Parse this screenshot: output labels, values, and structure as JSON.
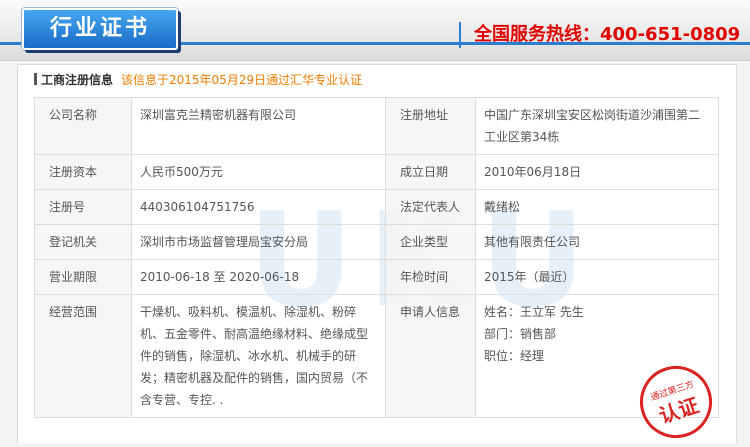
{
  "header": {
    "title": "行业证书",
    "hotline": "全国服务热线：400-651-0809"
  },
  "section": {
    "label": "工商注册信息",
    "note": "该信息于2015年05月29日通过汇华专业认证"
  },
  "rows": [
    {
      "k1": "公司名称",
      "v1": "深圳富克兰精密机器有限公司",
      "k2": "注册地址",
      "v2": "中国广东深圳宝安区松岗街道沙浦围第二工业区第34栋"
    },
    {
      "k1": "注册资本",
      "v1": "人民币500万元",
      "k2": "成立日期",
      "v2": "2010年06月18日"
    },
    {
      "k1": "注册号",
      "v1": "440306104751756",
      "k2": "法定代表人",
      "v2": "戴绪松"
    },
    {
      "k1": "登记机关",
      "v1": "深圳市市场监督管理局宝安分局",
      "k2": "企业类型",
      "v2": "其他有限责任公司"
    },
    {
      "k1": "营业期限",
      "v1": "2010-06-18 至 2020-06-18",
      "k2": "年检时间",
      "v2": "2015年（最近）"
    }
  ],
  "scope": {
    "k1": "经营范围",
    "v1": "干燥机、吸料机、模温机、除湿机、粉碎机、五金零件、耐高温绝缘材料、绝缘成型件的销售，除湿机、冰水机、机械手的研发；精密机器及配件的销售，国内贸易（不含专营、专控. .",
    "k2": "申请人信息",
    "contact": {
      "name": "姓名：王立军 先生",
      "dept": "部门：销售部",
      "title": "职位：经理"
    }
  },
  "watermark": "UKU",
  "stamp": {
    "top": "通过第三方",
    "main": "认证"
  }
}
